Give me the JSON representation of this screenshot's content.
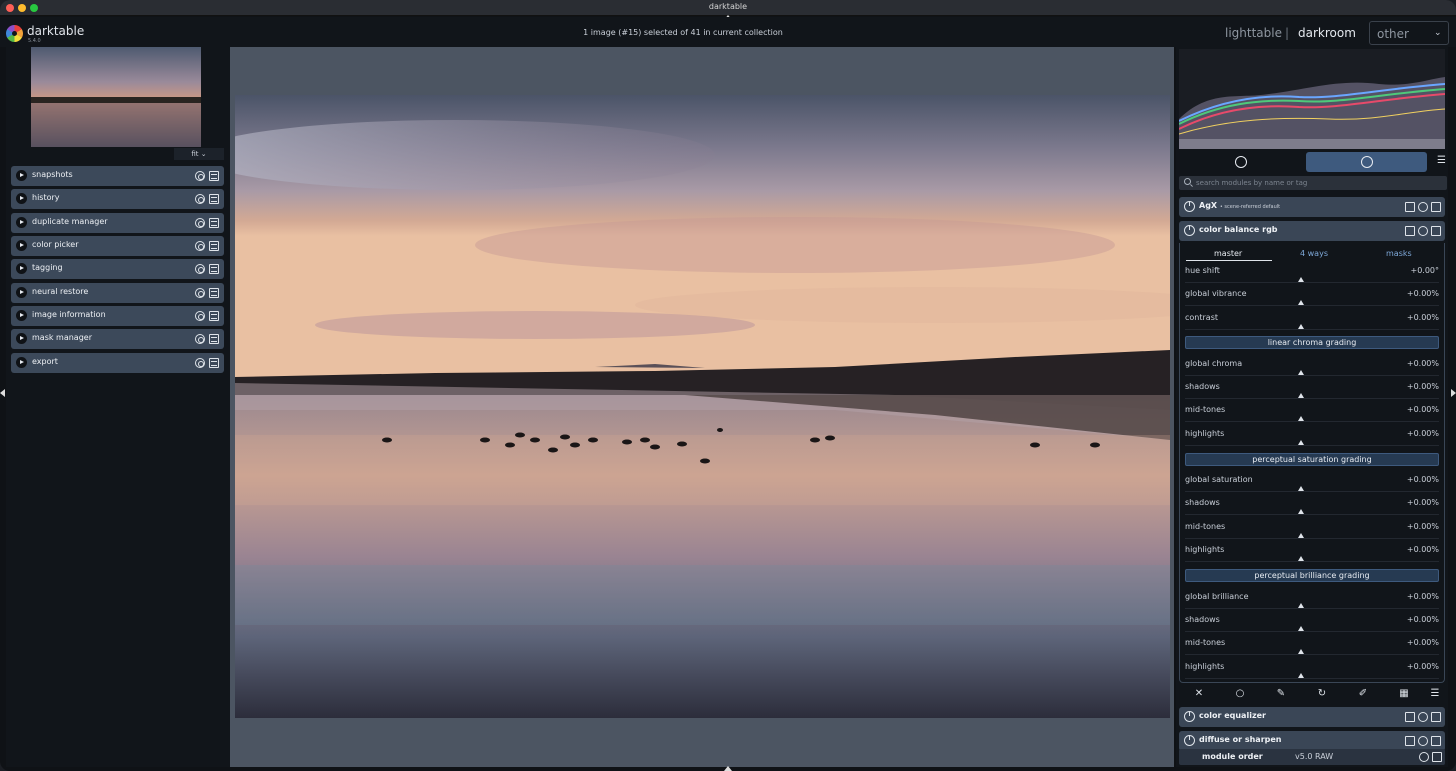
{
  "window": {
    "title": "darktable"
  },
  "header": {
    "app_name": "darktable",
    "app_version": "5.4.0",
    "collection_info": "1 image (#15) selected of 41 in current collection",
    "views": {
      "lighttable": "lighttable",
      "separator": "|",
      "darkroom": "darkroom",
      "other": "other"
    }
  },
  "navigation": {
    "zoom": "fit"
  },
  "left_modules": [
    {
      "label": "snapshots"
    },
    {
      "label": "history"
    },
    {
      "label": "duplicate manager"
    },
    {
      "label": "color picker"
    },
    {
      "label": "tagging"
    },
    {
      "label": "neural restore"
    },
    {
      "label": "image information"
    },
    {
      "label": "mask manager"
    },
    {
      "label": "export"
    }
  ],
  "right_panel": {
    "search_placeholder": "search modules by name or tag",
    "agx": {
      "label": "AgX",
      "subtitle": "• scene-referred default"
    },
    "color_balance": {
      "label": "color balance rgb",
      "tabs": {
        "master": "master",
        "four_ways": "4 ways",
        "masks": "masks"
      },
      "rows": [
        {
          "label": "hue shift",
          "value": "+0.00°"
        },
        {
          "label": "global vibrance",
          "value": "+0.00%"
        },
        {
          "label": "contrast",
          "value": "+0.00%"
        }
      ],
      "sections": {
        "linear_chroma": "linear chroma grading",
        "perceptual_saturation": "perceptual saturation grading",
        "perceptual_brilliance": "perceptual brilliance grading"
      },
      "chroma_rows": [
        {
          "label": "global chroma",
          "value": "+0.00%"
        },
        {
          "label": "shadows",
          "value": "+0.00%"
        },
        {
          "label": "mid-tones",
          "value": "+0.00%"
        },
        {
          "label": "highlights",
          "value": "+0.00%"
        }
      ],
      "saturation_rows": [
        {
          "label": "global saturation",
          "value": "+0.00%"
        },
        {
          "label": "shadows",
          "value": "+0.00%"
        },
        {
          "label": "mid-tones",
          "value": "+0.00%"
        },
        {
          "label": "highlights",
          "value": "+0.00%"
        }
      ],
      "brilliance_rows": [
        {
          "label": "global brilliance",
          "value": "+0.00%"
        },
        {
          "label": "shadows",
          "value": "+0.00%"
        },
        {
          "label": "mid-tones",
          "value": "+0.00%"
        },
        {
          "label": "highlights",
          "value": "+0.00%"
        }
      ]
    },
    "color_equalizer": {
      "label": "color equalizer"
    },
    "diffuse_sharpen": {
      "label": "diffuse or sharpen"
    },
    "module_order": {
      "label": "module order",
      "value": "v5.0 RAW"
    }
  },
  "colors": {
    "accent": "#3e5a7e",
    "module_header": "#3c495a",
    "panel_bg": "#11151a",
    "center_bg": "#4c5562"
  }
}
